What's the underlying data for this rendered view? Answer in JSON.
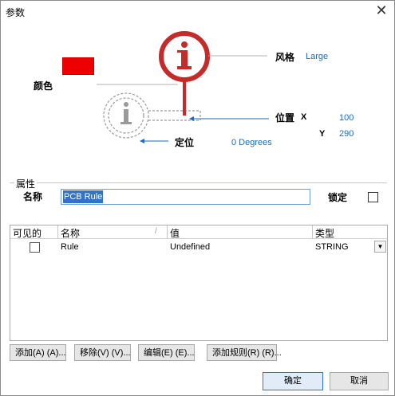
{
  "window": {
    "title": "参数",
    "close_icon": "close-icon"
  },
  "diagram": {
    "style_label": "风格",
    "style_value": "Large",
    "color_label": "颜色",
    "color_value": "#ee0000",
    "position_label": "位置",
    "x_label": "X",
    "x_value": "100",
    "y_label": "Y",
    "y_value": "290",
    "anchor_label": "定位",
    "rotation_value": "0 Degrees"
  },
  "properties": {
    "group_title": "属性",
    "name_label": "名称",
    "name_value": "PCB Rule",
    "lock_label": "锁定",
    "lock_checked": false
  },
  "table": {
    "columns": [
      "可见的",
      "名称",
      "值",
      "类型"
    ],
    "rows": [
      {
        "visible": false,
        "name": "Rule",
        "value": "Undefined",
        "type": "STRING"
      }
    ]
  },
  "buttons": {
    "add": "添加(A) (A)...",
    "remove": "移除(V) (V)...",
    "edit": "编辑(E) (E)...",
    "add_rule": "添加规则(R) (R)...",
    "ok": "确定",
    "cancel": "取消"
  }
}
